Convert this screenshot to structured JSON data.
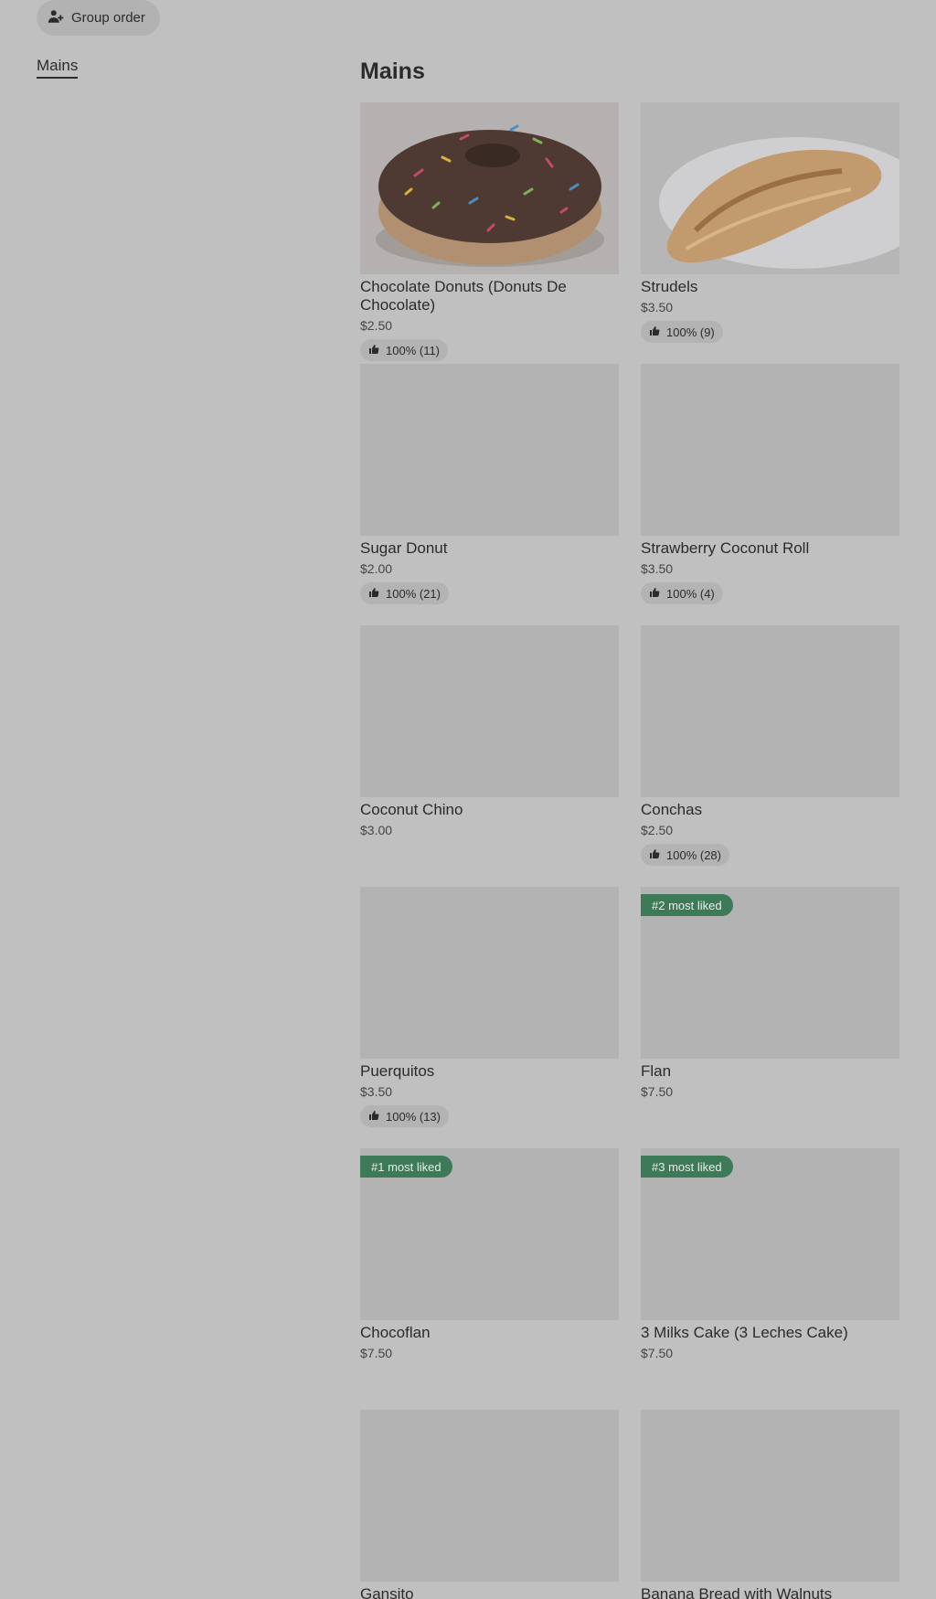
{
  "header": {
    "group_order_label": "Group order",
    "group_order_icon": "person-add-icon"
  },
  "sidebar": {
    "items": [
      {
        "label": "Mains",
        "active": true
      }
    ]
  },
  "section": {
    "title": "Mains"
  },
  "rating_icon": "thumbs-up-icon",
  "badge_color": "#3d7a57",
  "items": [
    {
      "name": "Chocolate Donuts (Donuts De Chocolate)",
      "price": "$2.50",
      "rating": "100% (11)",
      "badge": "",
      "image": "chocolate-donut"
    },
    {
      "name": "Strudels",
      "price": "$3.50",
      "rating": "100% (9)",
      "badge": "",
      "image": "strudel"
    },
    {
      "name": "Sugar Donut",
      "price": "$2.00",
      "rating": "100% (21)",
      "badge": "",
      "image": ""
    },
    {
      "name": "Strawberry  Coconut Roll",
      "price": "$3.50",
      "rating": "100% (4)",
      "badge": "",
      "image": ""
    },
    {
      "name": "Coconut Chino",
      "price": "$3.00",
      "rating": "",
      "badge": "",
      "image": ""
    },
    {
      "name": "Conchas",
      "price": "$2.50",
      "rating": "100% (28)",
      "badge": "",
      "image": ""
    },
    {
      "name": "Puerquitos",
      "price": "$3.50",
      "rating": "100% (13)",
      "badge": "",
      "image": ""
    },
    {
      "name": "Flan",
      "price": "$7.50",
      "rating": "",
      "badge": "#2 most liked",
      "image": ""
    },
    {
      "name": "Chocoflan",
      "price": "$7.50",
      "rating": "",
      "badge": "#1 most liked",
      "image": ""
    },
    {
      "name": "3 Milks Cake (3 Leches Cake)",
      "price": "$7.50",
      "rating": "",
      "badge": "#3 most liked",
      "image": ""
    },
    {
      "name": "Gansito",
      "price": "",
      "rating": "",
      "badge": "",
      "image": ""
    },
    {
      "name": "Banana Bread with Walnuts",
      "price": "",
      "rating": "",
      "badge": "",
      "image": ""
    }
  ]
}
